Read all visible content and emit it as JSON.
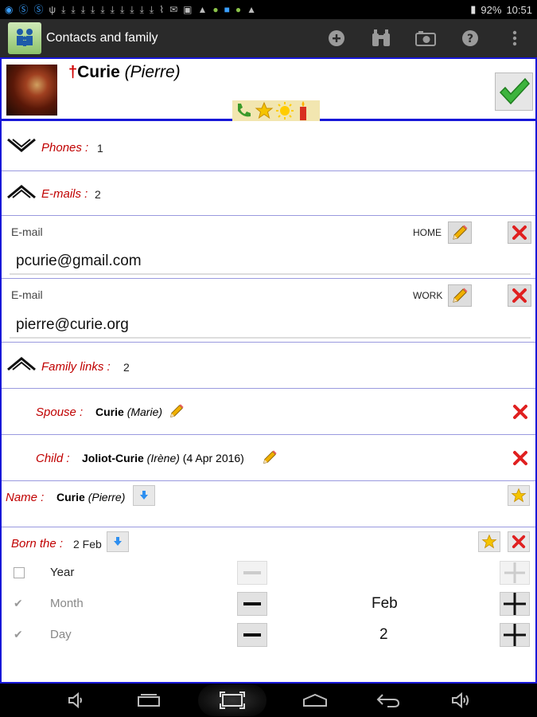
{
  "status_bar": {
    "battery": "92%",
    "time": "10:51"
  },
  "action_bar": {
    "title": "Contacts and family",
    "actions": [
      "add-icon",
      "binoculars-icon",
      "camera-icon",
      "help-icon",
      "overflow-menu-icon"
    ]
  },
  "contact": {
    "surname": "Curie",
    "firstname": "(Pierre)"
  },
  "phones": {
    "label": "Phones :",
    "count": "1"
  },
  "emails": {
    "label": "E-mails :",
    "count": "2",
    "items": [
      {
        "label": "E-mail",
        "type": "HOME",
        "value": "pcurie@gmail.com"
      },
      {
        "label": "E-mail",
        "type": "WORK",
        "value": "pierre@curie.org"
      }
    ]
  },
  "family_links": {
    "label": "Family links :",
    "count": "2",
    "items": [
      {
        "relation": "Spouse :",
        "surname": "Curie",
        "firstname": "(Marie)",
        "extra": ""
      },
      {
        "relation": "Child :",
        "surname": "Joliot-Curie",
        "firstname": "(Irène)",
        "extra": "(4 Apr 2016)"
      }
    ]
  },
  "name_row": {
    "label": "Name :",
    "surname": "Curie",
    "firstname": "(Pierre)"
  },
  "born": {
    "label": "Born the :",
    "value": "2 Feb",
    "fields": [
      {
        "label": "Year",
        "checked": false,
        "value": ""
      },
      {
        "label": "Month",
        "checked": true,
        "value": "Feb"
      },
      {
        "label": "Day",
        "checked": true,
        "value": "2"
      }
    ]
  },
  "colors": {
    "accent_blue": "#1818d8",
    "label_red": "#c00000",
    "action_bar": "#2a2a2a"
  }
}
